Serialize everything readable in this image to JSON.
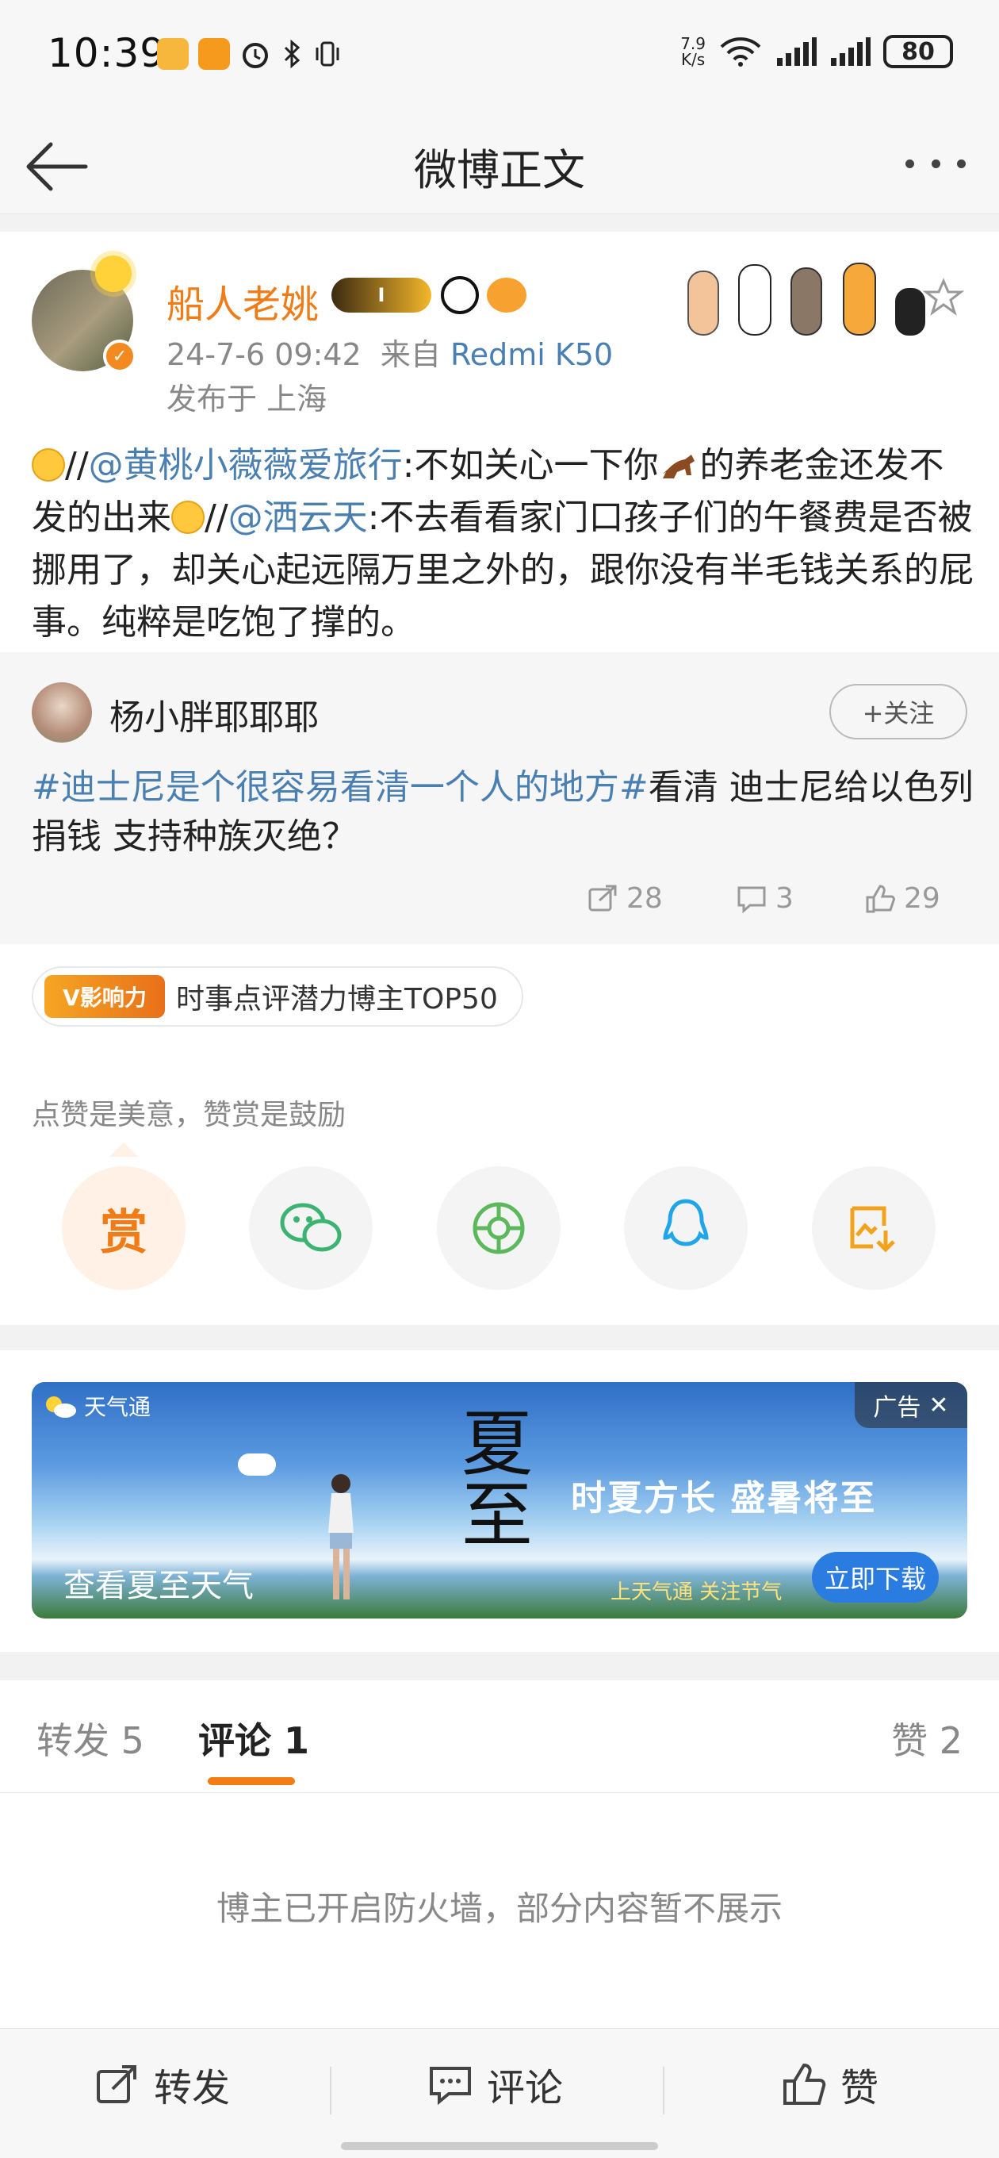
{
  "status_bar": {
    "time": "10:39",
    "net_speed_value": "7.9",
    "net_speed_unit": "K/s",
    "battery": "80"
  },
  "header": {
    "title": "微博正文"
  },
  "post": {
    "author": "船人老姚",
    "badge_level": "I",
    "time": "24-7-6 09:42",
    "source_prefix": "来自",
    "device": "Redmi K50",
    "location": "发布于 上海",
    "text": {
      "sep1": "//",
      "mention1": "@黄桃小薇薇爱旅行",
      "part1": ":不如关心一下你",
      "part2": "的养老金还发不发的出来",
      "sep2": "//",
      "mention2": "@洒云天",
      "part3": ":不去看看家门口孩子们的午餐费是否被挪用了，却关心起远隔万里之外的，跟你没有半毛钱关系的屁事。纯粹是吃饱了撑的。"
    }
  },
  "retweet": {
    "author": "杨小胖耶耶耶",
    "follow_label": "+关注",
    "tag": "#迪士尼是个很容易看清一个人的地方#",
    "text": "看清 迪士尼给以色列捐钱 支持种族灭绝？",
    "reposts": "28",
    "comments": "3",
    "likes": "29"
  },
  "influence": {
    "logo_text": "V影响力",
    "text": "时事点评潜力博主TOP50"
  },
  "reward": {
    "tip": "点赞是美意，赞赏是鼓励",
    "reward_char": "赏"
  },
  "share_icons": [
    "reward-icon",
    "wechat-icon",
    "moments-icon",
    "qq-icon",
    "save-image-icon"
  ],
  "ad": {
    "app_name": "天气通",
    "tag": "广告",
    "big_title": "夏至",
    "slogan": "时夏方长  盛暑将至",
    "caption": "查看夏至天气",
    "small_text": "上天气通  关注节气",
    "download": "立即下载"
  },
  "tabs": {
    "repost": "转发 5",
    "comment": "评论 1",
    "like": "赞 2"
  },
  "firewall_text": "博主已开启防火墙，部分内容暂不展示",
  "bottom_bar": {
    "repost": "转发",
    "comment": "评论",
    "like": "赞"
  },
  "colors": {
    "accent": "#f07c18",
    "link": "#4a7fb1",
    "tab_underline": "#f47c14"
  }
}
